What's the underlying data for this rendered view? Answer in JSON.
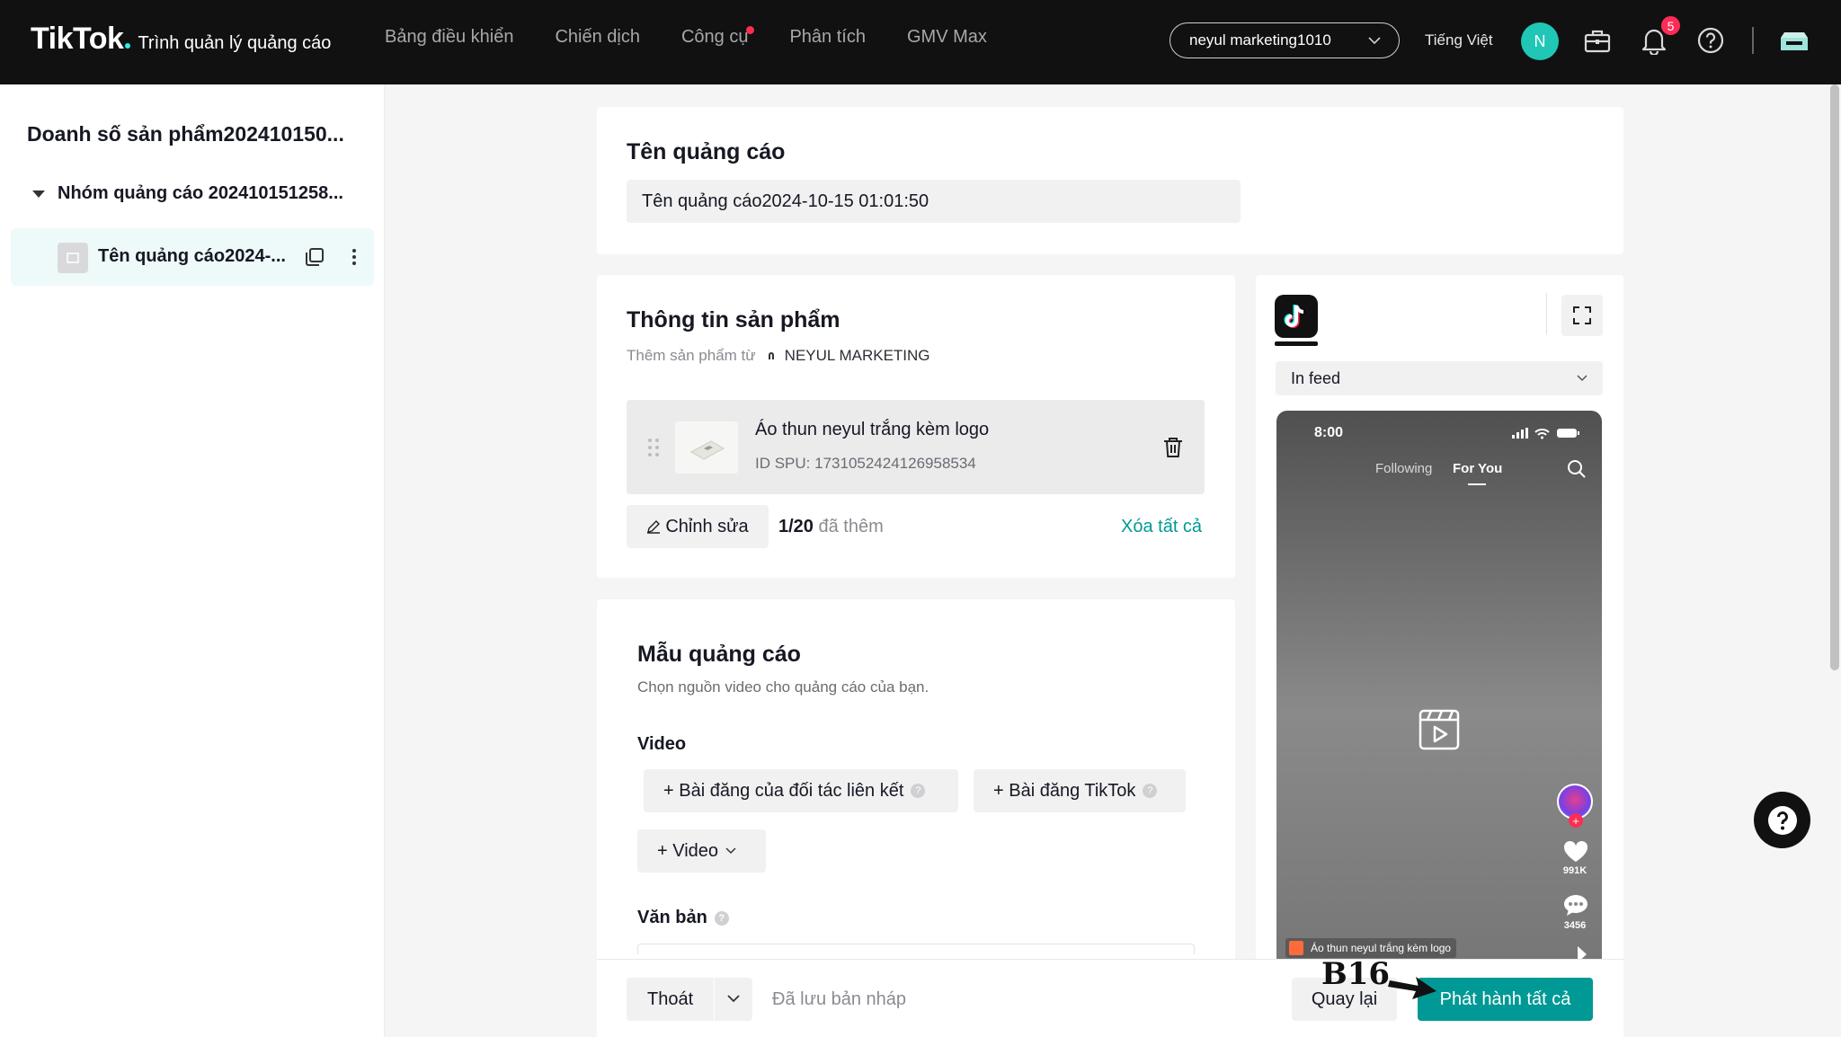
{
  "header": {
    "brand": "TikTok",
    "product": "Trình quản lý quảng cáo",
    "nav": [
      {
        "label": "Bảng điều khiển"
      },
      {
        "label": "Chiến dịch"
      },
      {
        "label": "Công cụ",
        "dot": true
      },
      {
        "label": "Phân tích"
      },
      {
        "label": "GMV Max"
      }
    ],
    "account": "neyul marketing1010",
    "language": "Tiếng Việt",
    "avatar_initial": "N",
    "notification_count": "5"
  },
  "sidebar": {
    "campaign": "Doanh số sản phẩm202410150...",
    "ad_group": "Nhóm quảng cáo 202410151258...",
    "ad": "Tên quảng cáo2024-..."
  },
  "ad_name": {
    "title": "Tên quảng cáo",
    "value": "Tên quảng cáo2024-10-15 01:01:50"
  },
  "product_info": {
    "title": "Thông tin sản phẩm",
    "source_prefix": "Thêm sản phẩm từ",
    "source_name": "NEYUL MARKETING",
    "product_name": "Áo thun neyul trắng kèm logo",
    "spu": "ID SPU: 1731052424126958534",
    "edit_label": "Chỉnh sửa",
    "count": "1/20",
    "count_suffix": "đã thêm",
    "clear_all": "Xóa tất cả"
  },
  "creative": {
    "title": "Mẫu quảng cáo",
    "subtitle": "Chọn nguồn video cho quảng cáo của bạn.",
    "video_label": "Video",
    "btn_affiliate": "+ Bài đăng của đối tác liên kết",
    "btn_tiktok_post": "+ Bài đăng TikTok",
    "btn_video": "+ Video",
    "text_label": "Văn bản"
  },
  "preview": {
    "placement": "In feed",
    "time": "8:00",
    "tab_following": "Following",
    "tab_foryou": "For You",
    "likes": "991K",
    "comments": "3456",
    "product_tag": "Áo thun neyul trắng kèm logo"
  },
  "footer": {
    "exit": "Thoát",
    "draft_status": "Đã lưu bản nháp",
    "back": "Quay lại",
    "publish": "Phát hành tất cả",
    "step_tag": "B16"
  },
  "colors": {
    "accent": "#009995",
    "topbar": "#111111",
    "badge": "#fe2c55"
  }
}
